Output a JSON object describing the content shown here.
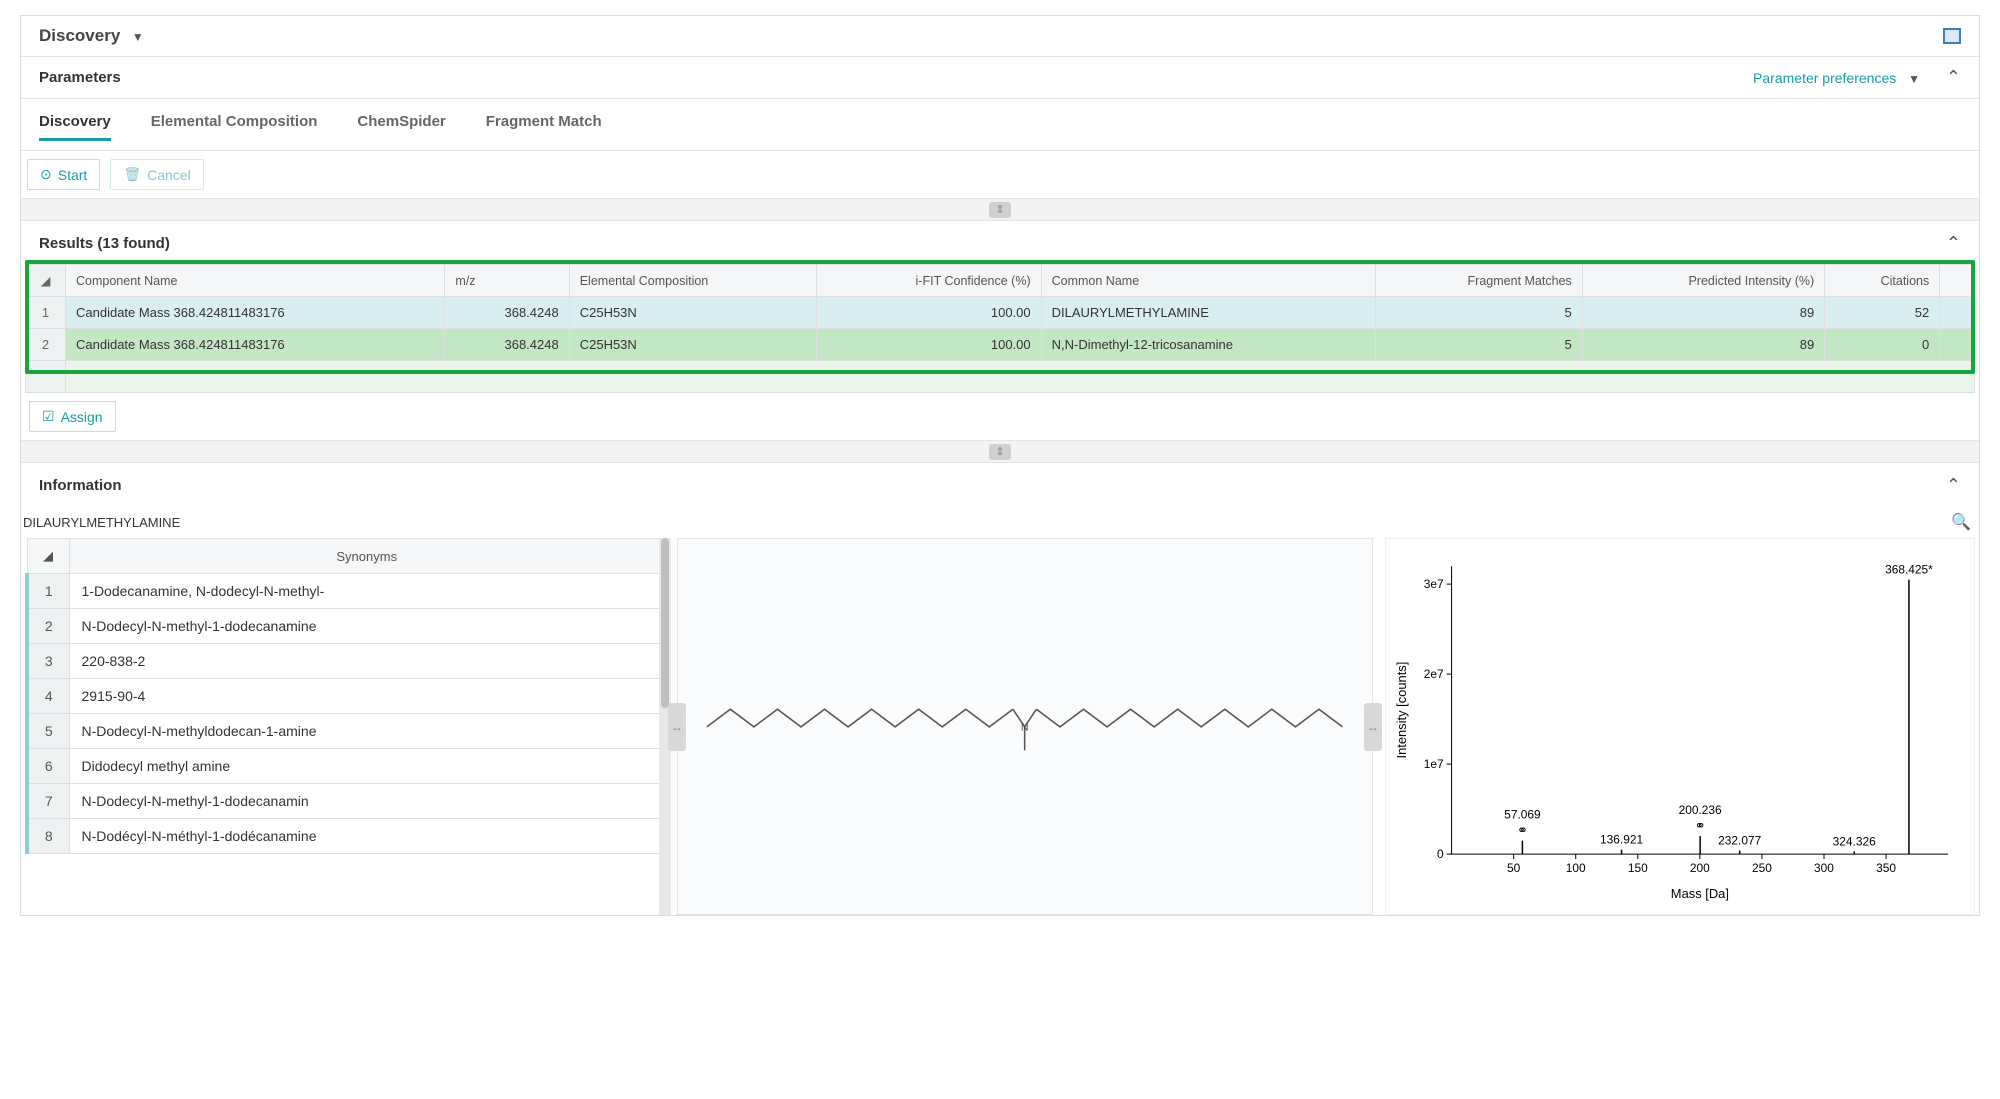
{
  "header": {
    "mode": "Discovery"
  },
  "parameters": {
    "title": "Parameters",
    "pref_link": "Parameter preferences",
    "tabs": [
      "Discovery",
      "Elemental Composition",
      "ChemSpider",
      "Fragment Match"
    ],
    "start": "Start",
    "cancel": "Cancel"
  },
  "results": {
    "title": "Results (13 found)",
    "columns": [
      "",
      "Component Name",
      "m/z",
      "Elemental Composition",
      "i-FIT Confidence (%)",
      "Common Name",
      "Fragment Matches",
      "Predicted Intensity (%)",
      "Citations"
    ],
    "rows": [
      {
        "idx": "1",
        "name": "Candidate Mass 368.424811483176",
        "mz": "368.4248",
        "ec": "C25H53N",
        "ifit": "100.00",
        "common": "DILAURYLMETHYLAMINE",
        "frag": "5",
        "pred": "89",
        "cit": "52"
      },
      {
        "idx": "2",
        "name": "Candidate Mass 368.424811483176",
        "mz": "368.4248",
        "ec": "C25H53N",
        "ifit": "100.00",
        "common": "N,N-Dimethyl-12-tricosanamine",
        "frag": "5",
        "pred": "89",
        "cit": "0"
      }
    ],
    "assign": "Assign"
  },
  "information": {
    "title": "Information",
    "compound": "DILAURYLMETHYLAMINE",
    "syn_header": "Synonyms",
    "synonyms": [
      "1-Dodecanamine, N-dodecyl-N-methyl-",
      "N-Dodecyl-N-methyl-1-dodecanamine",
      "220-838-2",
      "2915-90-4",
      "N-Dodecyl-N-methyldodecan-1-amine",
      "Didodecyl methyl amine",
      "N-Dodecyl-N-methyl-1-dodecanamin",
      "N-Dodécyl-N-méthyl-1-dodécanamine"
    ]
  },
  "chart_data": {
    "type": "bar",
    "title": "",
    "xlabel": "Mass [Da]",
    "ylabel": "Intensity [counts]",
    "xlim": [
      0,
      400
    ],
    "ylim": [
      0,
      32000000.0
    ],
    "xticks": [
      50,
      100,
      150,
      200,
      250,
      300,
      350
    ],
    "yticks": [
      0,
      10000000.0,
      20000000.0,
      30000000.0
    ],
    "ytick_labels": [
      "0",
      "1e7",
      "2e7",
      "3e7"
    ],
    "peaks": [
      {
        "mass": 57.069,
        "intensity": 1500000.0,
        "label": "57.069",
        "marker": true
      },
      {
        "mass": 136.921,
        "intensity": 500000.0,
        "label": "136.921",
        "marker": false
      },
      {
        "mass": 200.236,
        "intensity": 2000000.0,
        "label": "200.236",
        "marker": true
      },
      {
        "mass": 232.077,
        "intensity": 400000.0,
        "label": "232.077",
        "marker": false
      },
      {
        "mass": 324.326,
        "intensity": 300000.0,
        "label": "324.326",
        "marker": false
      },
      {
        "mass": 368.425,
        "intensity": 30500000.0,
        "label": "368.425*",
        "marker": false
      }
    ]
  }
}
